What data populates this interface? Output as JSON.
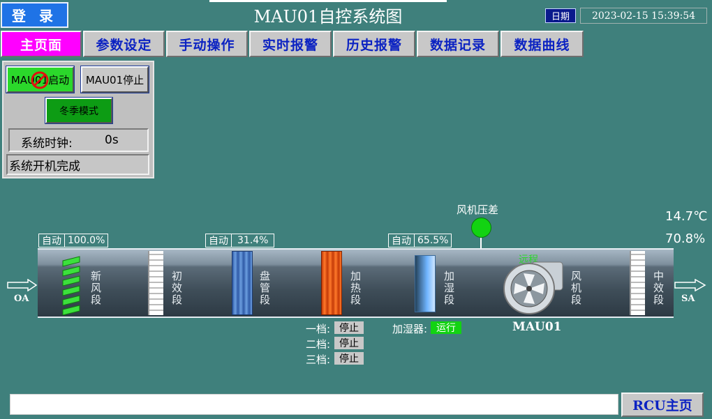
{
  "header": {
    "login_label": "登 录",
    "title": "MAU01自控系统图",
    "date_label": "日期",
    "datetime": "2023-02-15 15:39:54"
  },
  "nav": {
    "tabs": [
      {
        "label": "主页面",
        "active": true
      },
      {
        "label": "参数设定"
      },
      {
        "label": "手动操作"
      },
      {
        "label": "实时报警"
      },
      {
        "label": "历史报警"
      },
      {
        "label": "数据记录"
      },
      {
        "label": "数据曲线"
      }
    ]
  },
  "control": {
    "start_label": "MAU01启动",
    "stop_label": "MAU01停止",
    "mode_label": "冬季模式",
    "clock_label": "系统时钟:",
    "clock_value": "0s",
    "status": "系统开机完成"
  },
  "readouts": [
    {
      "mode": "自动",
      "value": "100.0%"
    },
    {
      "mode": "自动",
      "value": "31.4%"
    },
    {
      "mode": "自动",
      "value": "65.5%"
    }
  ],
  "sensors": {
    "fan_dp_label": "风机压差",
    "temperature": "14.7℃",
    "humidity": "70.8%",
    "remote_label": "远程"
  },
  "segments": {
    "fresh_air": "新风段",
    "primary": "初效段",
    "coil": "盘管段",
    "heating": "加热段",
    "humidify": "加湿段",
    "fan": "风机段",
    "medium": "中效段"
  },
  "ports": {
    "inlet": "OA",
    "outlet": "SA"
  },
  "heater_stages": [
    {
      "label": "一档:",
      "state": "停止"
    },
    {
      "label": "二档:",
      "state": "停止"
    },
    {
      "label": "三档:",
      "state": "停止"
    }
  ],
  "humidifier": {
    "label": "加湿器:",
    "state": "运行"
  },
  "unit_name": "MAU01",
  "footer": {
    "rcu_label": "RCU主页"
  },
  "colors": {
    "background": "#3f807c",
    "running": "#2bd82b",
    "nav_active": "#ff00ff",
    "nav_text": "#0b22c2"
  }
}
